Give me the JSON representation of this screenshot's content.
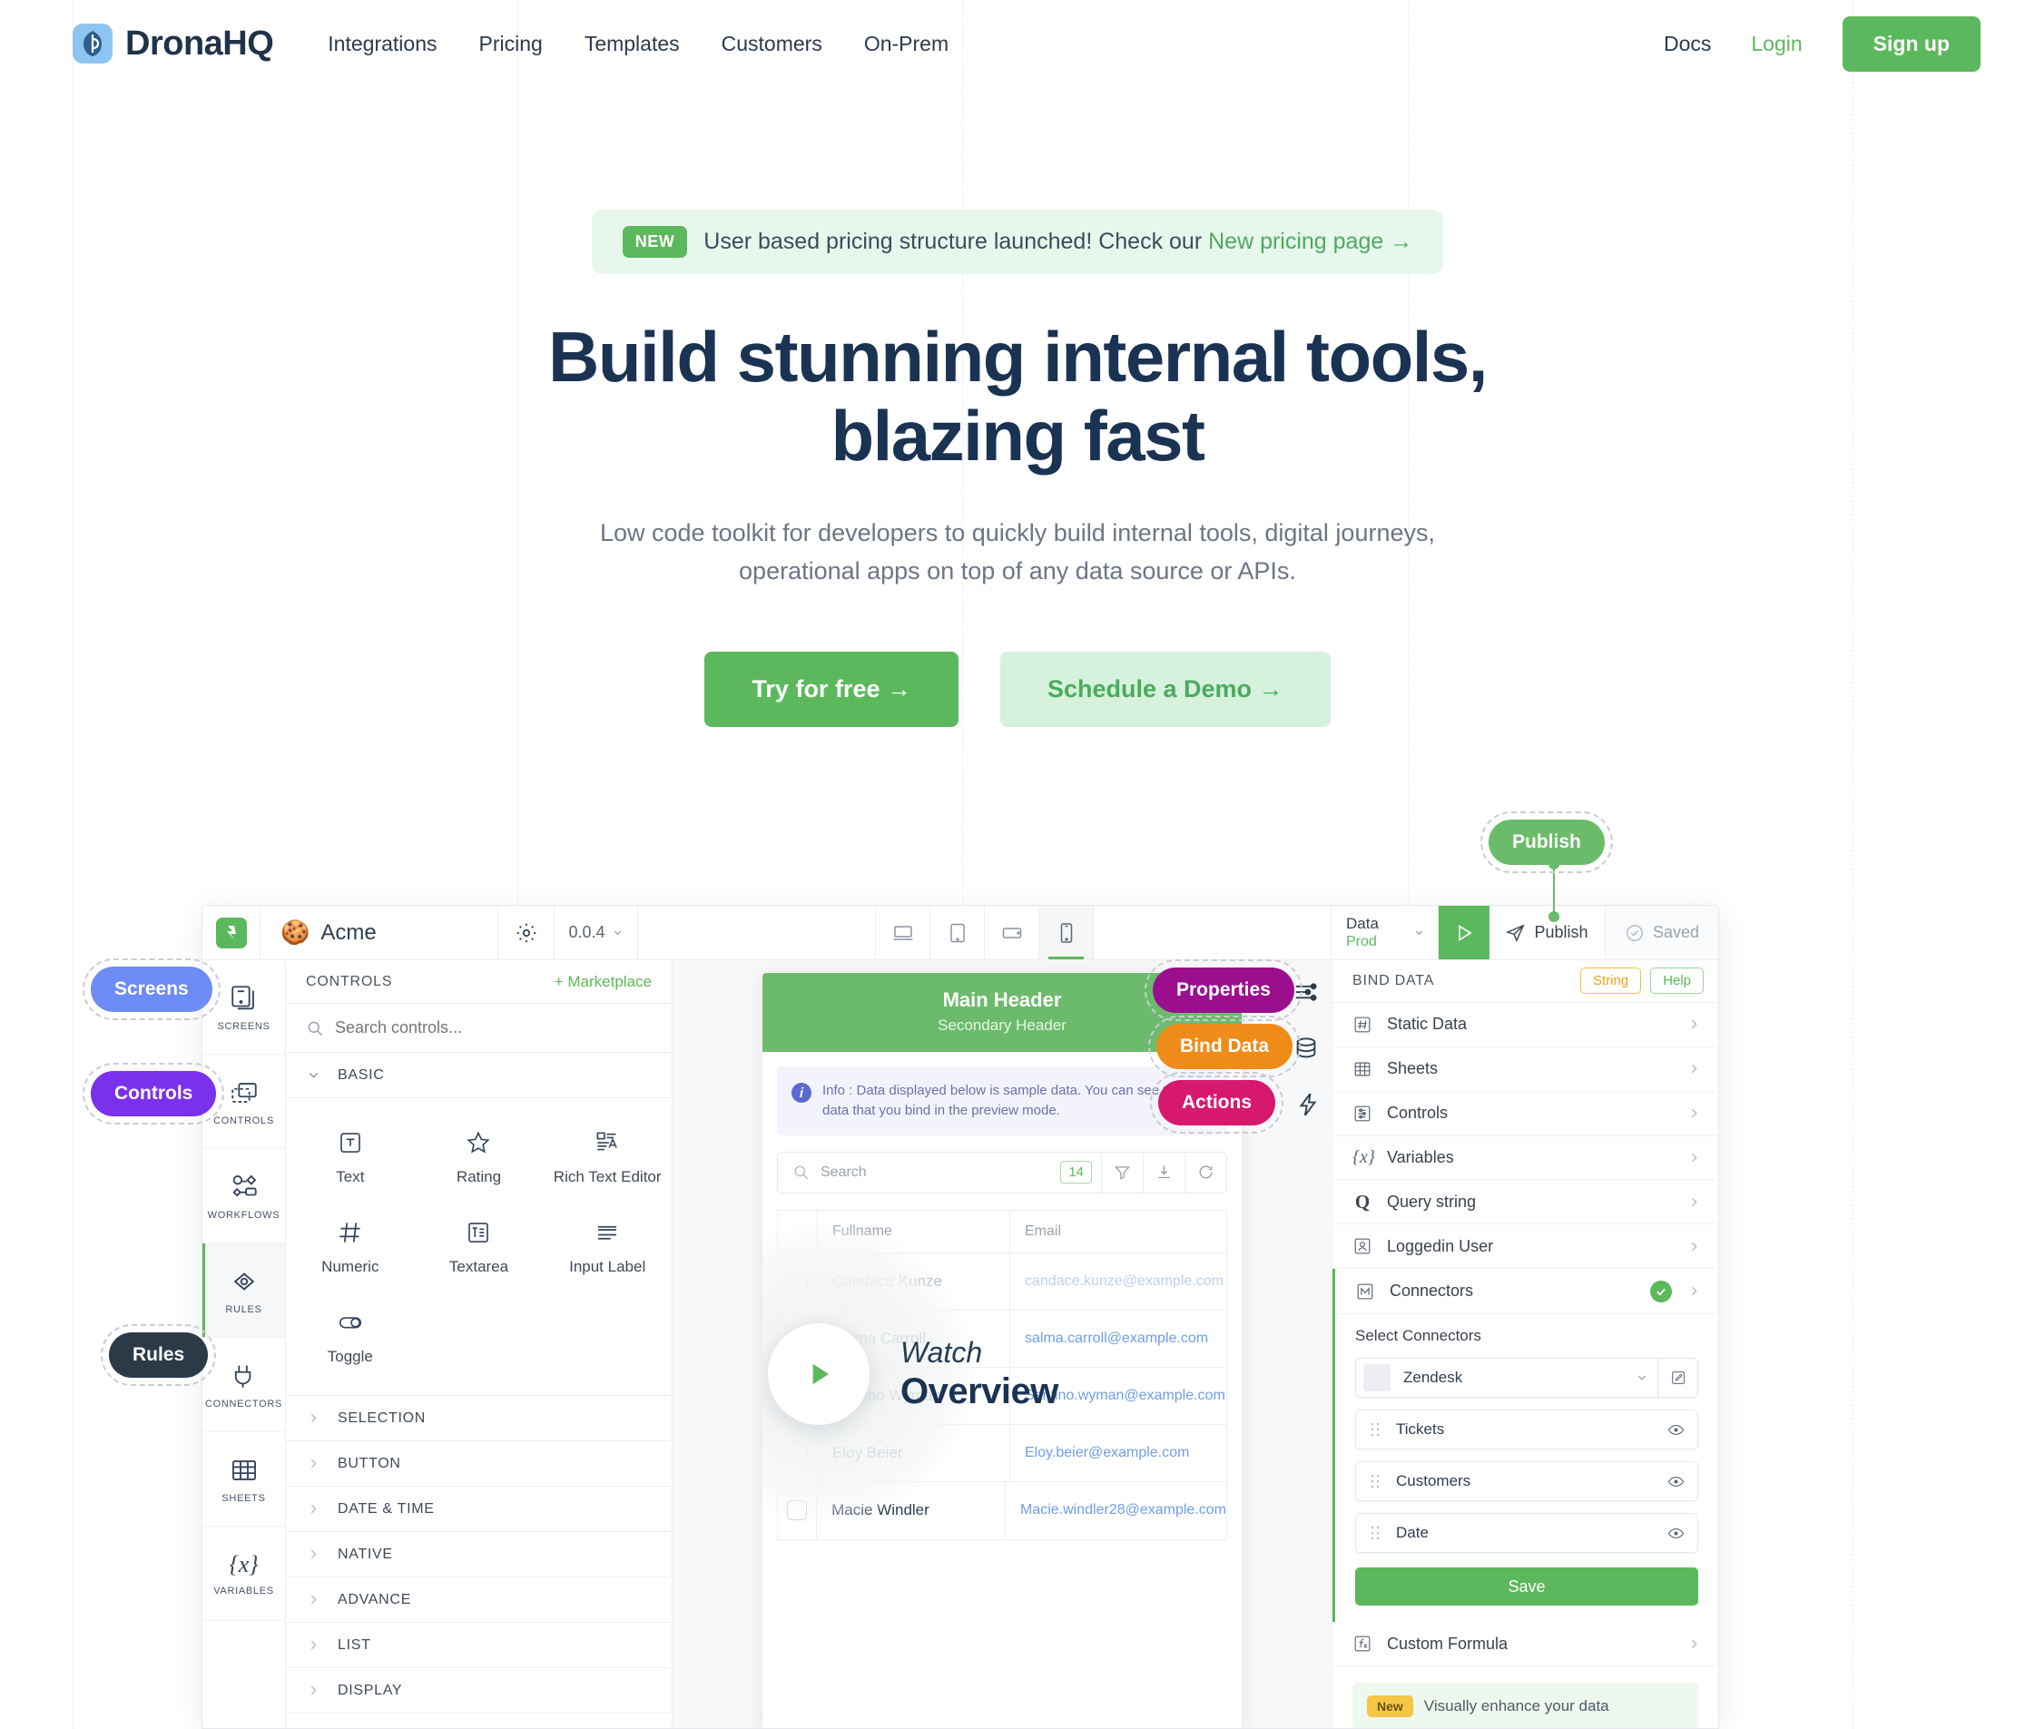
{
  "nav": {
    "brand": "DronaHQ",
    "links": [
      "Integrations",
      "Pricing",
      "Templates",
      "Customers",
      "On-Prem"
    ],
    "docs": "Docs",
    "login": "Login",
    "signup": "Sign up"
  },
  "hero": {
    "announce_badge": "NEW",
    "announce_text": "User based pricing structure launched! Check our ",
    "announce_link": "New pricing page →",
    "headline_line1": "Build stunning internal tools,",
    "headline_line2": "blazing fast",
    "sub_line1": "Low code toolkit for developers to quickly build internal tools, digital journeys,",
    "sub_line2": "operational apps on top of any data source or APIs.",
    "cta_primary": "Try for free →",
    "cta_secondary": "Schedule a Demo  →"
  },
  "annotations": {
    "screens": "Screens",
    "controls": "Controls",
    "rules": "Rules",
    "properties": "Properties",
    "bind_data": "Bind Data",
    "actions": "Actions",
    "publish": "Publish"
  },
  "app": {
    "toolbar": {
      "app_name": "Acme",
      "version": "0.0.4",
      "data_label": "Data",
      "data_env": "Prod",
      "publish": "Publish",
      "saved": "Saved"
    },
    "rail": [
      {
        "label": "SCREENS",
        "icon": "screens-icon",
        "active": false
      },
      {
        "label": "CONTROLS",
        "icon": "controls-icon",
        "active": false
      },
      {
        "label": "WORKFLOWS",
        "icon": "workflows-icon",
        "active": false
      },
      {
        "label": "RULES",
        "icon": "rules-icon",
        "active": true
      },
      {
        "label": "CONNECTORS",
        "icon": "connectors-icon",
        "active": false
      },
      {
        "label": "SHEETS",
        "icon": "sheets-icon",
        "active": false
      },
      {
        "label": "VARIABLES",
        "icon": "variables-icon",
        "active": false
      }
    ],
    "controls_panel": {
      "title": "CONTROLS",
      "marketplace": "+ Marketplace",
      "search_placeholder": "Search controls...",
      "basic_label": "BASIC",
      "items": [
        {
          "label": "Text",
          "icon": "text-icon"
        },
        {
          "label": "Rating",
          "icon": "star-icon"
        },
        {
          "label": "Rich Text Editor",
          "icon": "rich-text-icon"
        },
        {
          "label": "Numeric",
          "icon": "hash-icon"
        },
        {
          "label": "Textarea",
          "icon": "textarea-icon"
        },
        {
          "label": "Input Label",
          "icon": "input-label-icon"
        },
        {
          "label": "Toggle",
          "icon": "toggle-icon"
        }
      ],
      "groups": [
        "SELECTION",
        "BUTTON",
        "DATE & TIME",
        "NATIVE",
        "ADVANCE",
        "LIST",
        "DISPLAY"
      ]
    },
    "canvas": {
      "main_header": "Main Header",
      "secondary_header": "Secondary Header",
      "info_text": "Info : Data displayed below is sample data. You can see the real data that you bind in the preview mode.",
      "search_placeholder": "Search",
      "count_badge": "14",
      "columns": [
        "Fullname",
        "Email"
      ],
      "rows": [
        {
          "name": "Candace Kunze",
          "email": "candace.kunze@example.com"
        },
        {
          "name": "Salma Carroll",
          "email": "salma.carroll@example.com"
        },
        {
          "name": "Santino Wyman",
          "email": "Santino.wyman@example.com"
        },
        {
          "name": "Eloy Beier",
          "email": "Eloy.beier@example.com"
        },
        {
          "name": "Macie Windler",
          "email": "Macie.windler28@example.com"
        }
      ],
      "watch_line1": "Watch",
      "watch_line2": "Overview"
    },
    "bind_panel": {
      "title": "BIND DATA",
      "tag_string": "String",
      "tag_help": "Help",
      "items": [
        {
          "label": "Static Data",
          "icon": "hash-box-icon"
        },
        {
          "label": "Sheets",
          "icon": "sheets-icon"
        },
        {
          "label": "Controls",
          "icon": "sliders-icon"
        },
        {
          "label": "Variables",
          "icon": "variables-icon"
        },
        {
          "label": "Query string",
          "icon": "query-icon"
        },
        {
          "label": "Loggedin User",
          "icon": "user-icon"
        },
        {
          "label": "Connectors",
          "icon": "connector-m-icon"
        }
      ],
      "select_connectors_label": "Select Connectors",
      "connector_name": "Zendesk",
      "fields": [
        "Tickets",
        "Customers",
        "Date"
      ],
      "save_label": "Save",
      "custom_formula": "Custom Formula",
      "promo_badge": "New",
      "promo_text": "Visually enhance your data"
    }
  }
}
